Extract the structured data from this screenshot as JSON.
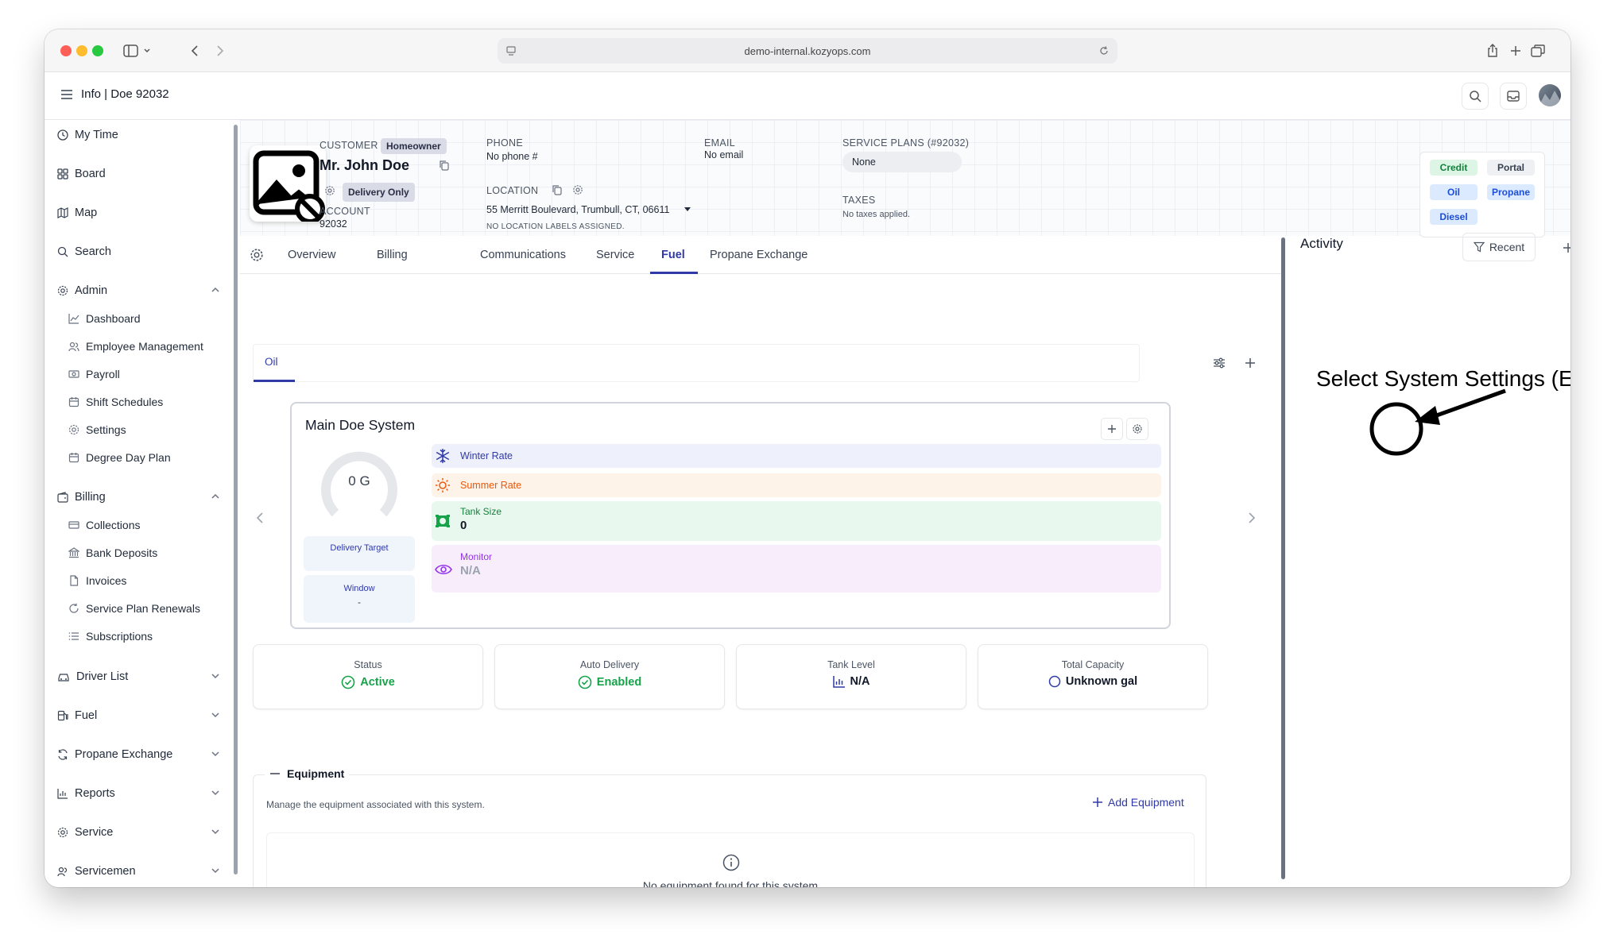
{
  "browser": {
    "url": "demo-internal.kozyops.com"
  },
  "header": {
    "title": "Info | Doe 92032"
  },
  "sidebar": {
    "items": [
      {
        "label": "My Time"
      },
      {
        "label": "Board"
      },
      {
        "label": "Map"
      },
      {
        "label": "Search"
      }
    ],
    "admin": {
      "label": "Admin",
      "children": [
        "Dashboard",
        "Employee Management",
        "Payroll",
        "Shift Schedules",
        "Settings",
        "Degree Day Plan"
      ]
    },
    "billing": {
      "label": "Billing",
      "children": [
        "Collections",
        "Bank Deposits",
        "Invoices",
        "Service Plan Renewals",
        "Subscriptions"
      ]
    },
    "collapsed": [
      "Driver List",
      "Fuel",
      "Propane Exchange",
      "Reports",
      "Service",
      "Servicemen"
    ]
  },
  "customer": {
    "type_label": "CUSTOMER",
    "type_badge": "Homeowner",
    "name": "Mr. John Doe",
    "delivery_badge": "Delivery Only",
    "account_label": "ACCOUNT",
    "account_number": "92032",
    "phone_label": "PHONE",
    "phone_value": "No phone #",
    "email_label": "EMAIL",
    "email_value": "No email",
    "location_label": "LOCATION",
    "location_value": "55 Merritt Boulevard, Trumbull, CT, 06611",
    "location_labels": "NO LOCATION LABELS ASSIGNED.",
    "service_plans_label": "SERVICE PLANS (#92032)",
    "service_plans_value": "None",
    "taxes_label": "TAXES",
    "taxes_value": "No taxes applied.",
    "tags": [
      "Credit",
      "Portal",
      "Oil",
      "Propane",
      "Diesel"
    ]
  },
  "tabs": [
    "Overview",
    "Billing",
    "Communications",
    "Service",
    "Fuel",
    "Propane Exchange"
  ],
  "active_tab": "Fuel",
  "fuel_subtab": "Oil",
  "system": {
    "name": "Main Doe System",
    "gauge_value": "0 G",
    "gauge_fill": 0,
    "delivery_target_label": "Delivery Target",
    "window_label": "Window",
    "window_value": "-",
    "winter_rate_label": "Winter Rate",
    "summer_rate_label": "Summer Rate",
    "tank_size_label": "Tank Size",
    "tank_size_value": "0",
    "monitor_label": "Monitor",
    "monitor_value": "N/A"
  },
  "annotation": {
    "text": "Select System Settings (Edit)"
  },
  "stats": [
    {
      "label": "Status",
      "value": "Active"
    },
    {
      "label": "Auto Delivery",
      "value": "Enabled"
    },
    {
      "label": "Tank Level",
      "value": "N/A"
    },
    {
      "label": "Total Capacity",
      "value": "Unknown gal"
    }
  ],
  "equipment": {
    "title": "Equipment",
    "description": "Manage the equipment associated with this system.",
    "add_label": "Add Equipment",
    "empty_text": "No equipment found for this system"
  },
  "activity": {
    "title": "Activity",
    "filter_label": "Recent"
  },
  "colors": {
    "accent": "#2f3aa8",
    "winter_bg": "#eef0fb",
    "summer_bg": "#fdf3e9",
    "tank_bg": "#e9f8ee",
    "monitor_bg": "#f8eefb",
    "active_green": "#16a34a"
  }
}
